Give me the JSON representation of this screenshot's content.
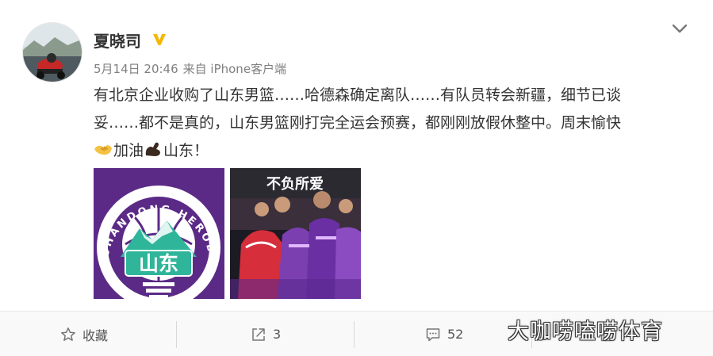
{
  "post": {
    "author": "夏晓司",
    "verified_icon": "verified-v-badge",
    "date": "5月14日 20:46",
    "source": "来自 iPhone客户端",
    "text_line1": "有北京企业收购了山东男篮……哈德森确定离队……有队员转会新疆，细节已谈",
    "text_line2": "妥……都不是真的，山东男篮刚打完全运会预赛，都刚刚放假休整中。周末愉快",
    "text_line3_a": "加油",
    "text_line3_b": "山东！",
    "emoji_1": "handshake-emoji",
    "emoji_2": "flexed-biceps-emoji",
    "logo_badge_char": "山东",
    "logo_ring_text": "SHANDONG HEROES",
    "photo_banner_text": "不负所爱"
  },
  "actions": {
    "favorite_label": "收藏",
    "share_count": "3",
    "comment_count": "52",
    "like_count": ""
  },
  "watermark": "大咖唠嗑唠体育",
  "colors": {
    "text": "#333333",
    "meta": "#808080",
    "logo_purple": "#5b2a86",
    "logo_green": "#2fb59a",
    "verified_gold": "#f5b800"
  }
}
